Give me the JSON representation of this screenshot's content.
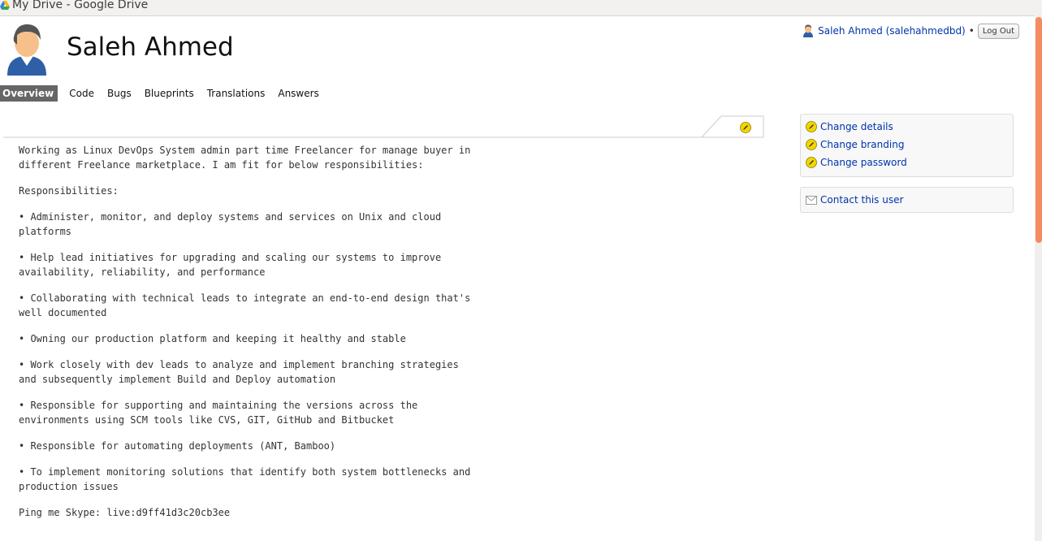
{
  "window": {
    "title": "My Drive - Google Drive"
  },
  "header": {
    "name": "Saleh Ahmed",
    "login_user": "Saleh Ahmed (salehahmedbd)",
    "separator": "•",
    "logout_label": "Log Out"
  },
  "tabs": [
    {
      "label": "Overview",
      "active": true
    },
    {
      "label": "Code",
      "active": false
    },
    {
      "label": "Bugs",
      "active": false
    },
    {
      "label": "Blueprints",
      "active": false
    },
    {
      "label": "Translations",
      "active": false
    },
    {
      "label": "Answers",
      "active": false
    }
  ],
  "description": {
    "paragraphs": [
      "Working as Linux DevOps System admin part time Freelancer for manage buyer in\ndifferent Freelance marketplace. I am fit for below responsibilities:",
      "Responsibilities:",
      "• Administer, monitor, and deploy systems and services on Unix and cloud\nplatforms",
      "• Help lead initiatives for upgrading and scaling our systems to improve\navailability, reliability, and performance",
      "• Collaborating with technical leads to integrate an end-to-end design that's\nwell documented",
      "• Owning our production platform and keeping it healthy and stable",
      "• Work closely with dev leads to analyze and implement branching strategies\nand subsequently implement Build and Deploy automation",
      "• Responsible for supporting and maintaining the versions across the\nenvironments using SCM tools like CVS, GIT, GitHub and Bitbucket",
      "• Responsible for automating deployments (ANT, Bamboo)",
      "• To implement monitoring solutions that identify both system bottlenecks and\nproduction issues",
      "Ping me Skype: live:d9ff41d3c20cb3ee"
    ]
  },
  "sidebar": {
    "actions": [
      {
        "label": "Change details",
        "icon": "edit-icon"
      },
      {
        "label": "Change branding",
        "icon": "edit-icon"
      },
      {
        "label": "Change password",
        "icon": "edit-icon"
      }
    ],
    "contact": {
      "label": "Contact this user",
      "icon": "mail-icon"
    }
  },
  "colors": {
    "link": "#0033aa",
    "active_tab_bg": "#666666",
    "scroll_thumb": "#f58c5f",
    "edit_icon": "#f2d600"
  }
}
